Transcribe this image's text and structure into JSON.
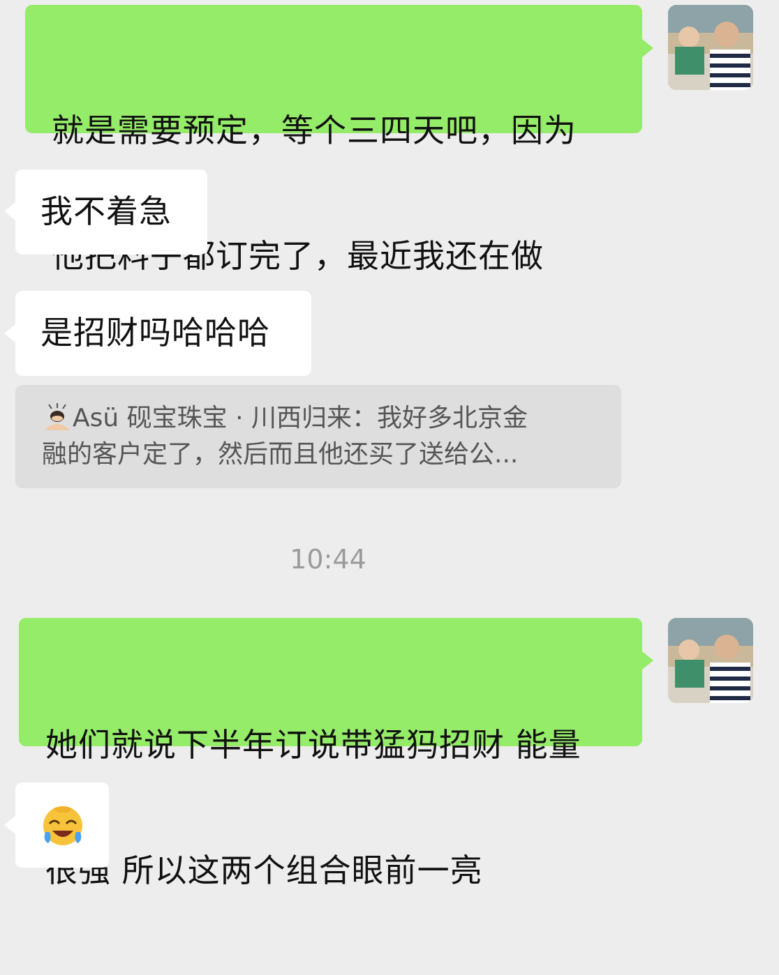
{
  "messages": [
    {
      "side": "me",
      "text": "就是需要预定，等个三四天吧，因为他把料子都订完了，最近我还在做"
    },
    {
      "side": "them",
      "text": "我不着急"
    },
    {
      "side": "them",
      "text": "是招财吗哈哈哈"
    },
    {
      "side": "them_emoji",
      "emoji": "face-with-tears-of-joy"
    },
    {
      "side": "me",
      "text": "她们就说下半年订说带猛犸招财 能量很强 所以这两个组合眼前一亮"
    }
  ],
  "msg1": {
    "line1": "就是需要预定，等个三四天吧，因为",
    "line2": "他把料子都订完了，最近我还在做"
  },
  "msg2": {
    "text": "我不着急"
  },
  "msg3": {
    "text": "是招财吗哈哈哈"
  },
  "quote": {
    "author": "Asü 砚宝珠宝 · 川西归来",
    "separator": "：",
    "line1_rest": "我好多北京金",
    "line2": "融的客户定了，然后而且他还买了送给公..."
  },
  "timestamp": "10:44",
  "msg4": {
    "line1": "她们就说下半年订说带猛犸招财 能量",
    "line2": "很强 所以这两个组合眼前一亮"
  },
  "colors": {
    "sent_bubble": "#95ec69",
    "received_bubble": "#ffffff",
    "background": "#ededed"
  }
}
